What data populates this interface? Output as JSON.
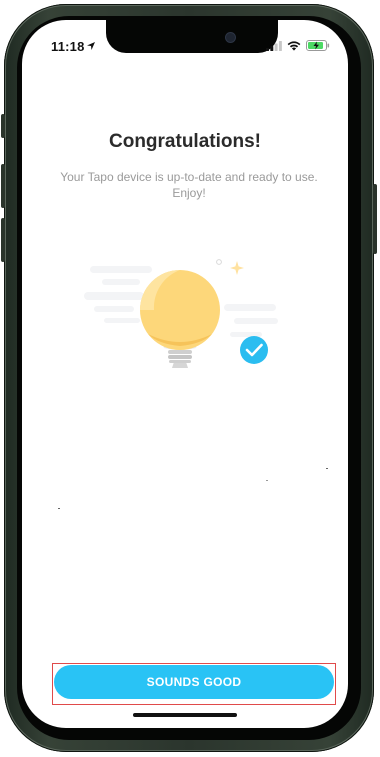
{
  "status_bar": {
    "time": "11:18",
    "icons": [
      "location-arrow-icon",
      "cellular-signal-icon",
      "wifi-icon",
      "battery-charging-icon"
    ]
  },
  "main": {
    "title": "Congratulations!",
    "message": "Your Tapo device is up-to-date and ready to use. Enjoy!",
    "illustration_icons": [
      "light-bulb-icon",
      "checkmark-badge-icon",
      "sparkle-icon"
    ]
  },
  "footer": {
    "primary_button_label": "SOUNDS GOOD"
  },
  "colors": {
    "accent": "#29c3f5",
    "bulb_yellow": "#fdd77a",
    "check_badge": "#2bbdf0",
    "highlight": "#e04a4a"
  }
}
